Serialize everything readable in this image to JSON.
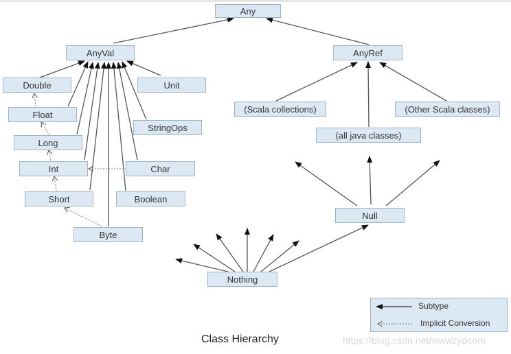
{
  "diagram": {
    "caption": "Class Hierarchy",
    "watermark": "https://blog.csdn.net/wwwzydcom",
    "nodes": {
      "any": "Any",
      "anyval": "AnyVal",
      "anyref": "AnyRef",
      "double": "Double",
      "float": "Float",
      "long": "Long",
      "int": "Int",
      "short": "Short",
      "byte": "Byte",
      "unit": "Unit",
      "stringops": "StringOps",
      "char": "Char",
      "boolean": "Boolean",
      "scala_collections": "(Scala collections)",
      "java_classes": "(all java classes)",
      "other_scala": "(Other Scala classes)",
      "null": "Null",
      "nothing": "Nothing"
    },
    "edges": {
      "subtype": [
        [
          "anyval",
          "any"
        ],
        [
          "anyref",
          "any"
        ],
        [
          "double",
          "anyval"
        ],
        [
          "float",
          "anyval"
        ],
        [
          "long",
          "anyval"
        ],
        [
          "int",
          "anyval"
        ],
        [
          "short",
          "anyval"
        ],
        [
          "byte",
          "anyval"
        ],
        [
          "boolean",
          "anyval"
        ],
        [
          "char",
          "anyval"
        ],
        [
          "stringops",
          "anyval"
        ],
        [
          "unit",
          "anyval"
        ],
        [
          "scala_collections",
          "anyref"
        ],
        [
          "java_classes",
          "anyref"
        ],
        [
          "other_scala",
          "anyref"
        ],
        [
          "nothing",
          "null"
        ]
      ],
      "implicit_conversion": [
        [
          "float",
          "double"
        ],
        [
          "long",
          "float"
        ],
        [
          "int",
          "long"
        ],
        [
          "short",
          "int"
        ],
        [
          "char",
          "int"
        ],
        [
          "byte",
          "short"
        ]
      ]
    },
    "legend": {
      "subtype": "Subtype",
      "implicit": "Implicit Conversion"
    }
  }
}
